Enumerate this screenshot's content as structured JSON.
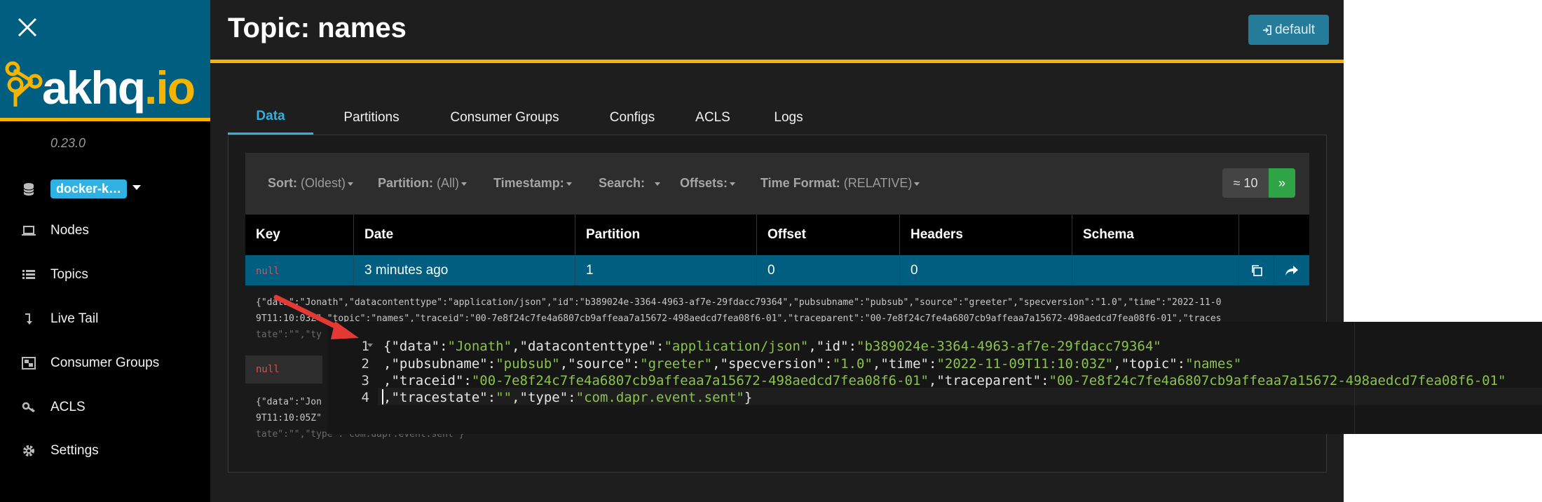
{
  "app": {
    "brand_prefix": "akhq",
    "brand_suffix": ".io",
    "version": "0.23.0"
  },
  "sidebar": {
    "cluster": "docker-k…",
    "items": [
      {
        "label": "Nodes",
        "icon": "laptop-icon"
      },
      {
        "label": "Topics",
        "icon": "list-icon"
      },
      {
        "label": "Live Tail",
        "icon": "level-down-icon"
      },
      {
        "label": "Consumer Groups",
        "icon": "object-group-icon"
      },
      {
        "label": "ACLS",
        "icon": "key-icon"
      },
      {
        "label": "Settings",
        "icon": "gear-icon"
      }
    ]
  },
  "header": {
    "title": "Topic: names",
    "user_button": "default"
  },
  "tabs": [
    {
      "label": "Data",
      "active": true
    },
    {
      "label": "Partitions",
      "active": false
    },
    {
      "label": "Consumer Groups",
      "active": false
    },
    {
      "label": "Configs",
      "active": false
    },
    {
      "label": "ACLS",
      "active": false
    },
    {
      "label": "Logs",
      "active": false
    }
  ],
  "filters": {
    "sort_label": "Sort:",
    "sort_value": "(Oldest)",
    "partition_label": "Partition:",
    "partition_value": "(All)",
    "timestamp_label": "Timestamp:",
    "search_label": "Search:",
    "offsets_label": "Offsets:",
    "time_format_label": "Time Format:",
    "time_format_value": "(RELATIVE)",
    "count": "≈ 10",
    "next": "»"
  },
  "table": {
    "columns": [
      "Key",
      "Date",
      "Partition",
      "Offset",
      "Headers",
      "Schema"
    ],
    "row1": {
      "key": "null",
      "date": "3 minutes ago",
      "partition": "1",
      "offset": "0",
      "headers": "0",
      "schema": ""
    },
    "row1_raw": [
      "{\"data\":\"Jonath\",\"datacontenttype\":\"application/json\",\"id\":\"b389024e-3364-4963-af7e-29fdacc79364\",\"pubsubname\":\"pubsub\",\"source\":\"greeter\",\"specversion\":\"1.0\",\"time\":\"2022-11-0",
      "9T11:10:03Z\",\"topic\":\"names\",\"traceid\":\"00-7e8f24c7fe4a6807cb9affeaa7a15672-498aedcd7fea08f6-01\",\"traceparent\":\"00-7e8f24c7fe4a6807cb9affeaa7a15672-498aedcd7fea08f6-01\",\"traces",
      "tate\":\"\",\"ty"
    ],
    "row2_key": "null",
    "row2_raw": [
      "{\"data\":\"Jon",
      "9T11:10:05Z\"",
      "tate\":\"\",\"type\":\"com.dapr.event.sent\"}"
    ]
  },
  "code_popup": {
    "line_numbers": [
      "1",
      "2",
      "3",
      "4"
    ],
    "lines": [
      "{\"data\":\"Jonath\",\"datacontenttype\":\"application/json\",\"id\":\"b389024e-3364-4963-af7e-29fdacc79364\"",
      ",\"pubsubname\":\"pubsub\",\"source\":\"greeter\",\"specversion\":\"1.0\",\"time\":\"2022-11-09T11:10:03Z\",\"topic\":\"names\"",
      ",\"traceid\":\"00-7e8f24c7fe4a6807cb9affeaa7a15672-498aedcd7fea08f6-01\",\"traceparent\":\"00-7e8f24c7fe4a6807cb9affeaa7a15672-498aedcd7fea08f6-01\"",
      ",\"tracestate\":\"\",\"type\":\"com.dapr.event.sent\"}"
    ]
  },
  "colors": {
    "brand_blue": "#005f81",
    "brand_yellow": "#f5b400",
    "accent": "#2fb1e3",
    "json_string": "#8bc34a",
    "null_red": "#e8494c",
    "arrow_red": "#e53935",
    "next_green": "#2ea447"
  }
}
